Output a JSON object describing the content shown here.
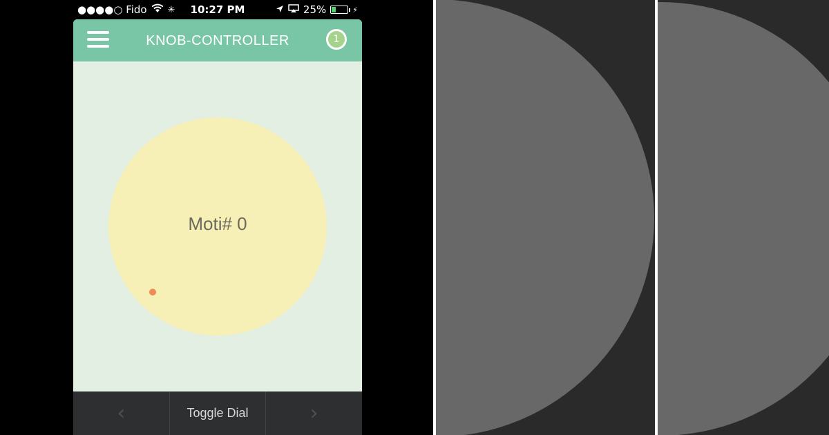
{
  "status": {
    "carrier": "●●●●○ Fido",
    "time": "10:27 PM",
    "battery_percent": "25%",
    "battery_level": 0.25
  },
  "header": {
    "title": "KNOB-CONTROLLER",
    "badge": "1"
  },
  "dial": {
    "label": "Moti# 0"
  },
  "bottombar": {
    "toggle_label": "Toggle Dial",
    "prev_icon": "chevron-left-icon",
    "next_icon": "chevron-right-icon"
  },
  "colors": {
    "header": "#79c6a6",
    "app_background": "#e3efe3",
    "dial": "#f6efb6",
    "dot": "#ef8a58",
    "bottombar": "#2e2f31",
    "pane_background": "#2a2a2a",
    "disc": "#686868"
  }
}
